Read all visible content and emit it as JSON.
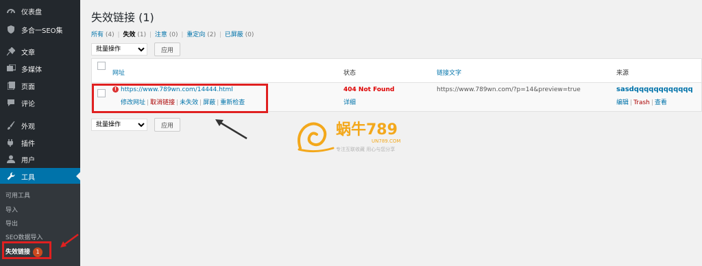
{
  "sidebar": {
    "items": [
      {
        "label": "仪表盘",
        "icon": "dashboard-icon"
      },
      {
        "label": "多合一SEO集",
        "icon": "seo-shield-icon"
      },
      {
        "label": "文章",
        "icon": "pin-icon"
      },
      {
        "label": "多媒体",
        "icon": "media-icon"
      },
      {
        "label": "页面",
        "icon": "page-icon"
      },
      {
        "label": "评论",
        "icon": "comment-icon"
      },
      {
        "label": "外观",
        "icon": "brush-icon"
      },
      {
        "label": "插件",
        "icon": "plugin-icon"
      },
      {
        "label": "用户",
        "icon": "user-icon"
      },
      {
        "label": "工具",
        "icon": "wrench-icon"
      }
    ],
    "submenu": [
      {
        "label": "可用工具"
      },
      {
        "label": "导入"
      },
      {
        "label": "导出"
      },
      {
        "label": "SEO数据导入"
      },
      {
        "label": "失效链接",
        "badge": "1"
      }
    ]
  },
  "main": {
    "title": "失效链接 (1)",
    "filters": [
      {
        "label": "所有",
        "count": "(4)"
      },
      {
        "label": "失效",
        "count": "(1)"
      },
      {
        "label": "注意",
        "count": "(0)"
      },
      {
        "label": "重定向",
        "count": "(2)"
      },
      {
        "label": "已屏蔽",
        "count": "(0)"
      }
    ],
    "bulk": {
      "select_value": "批量操作",
      "apply_label": "应用"
    },
    "table": {
      "headers": {
        "url": "网址",
        "status": "状态",
        "link_text": "链接文字",
        "source": "来源"
      },
      "row": {
        "url": "https://www.789wn.com/14444.html",
        "actions": [
          "修改网址",
          "取消链接",
          "未失效",
          "屏蔽",
          "重新检查"
        ],
        "status": "404 Not Found",
        "status_detail": "详细",
        "link_text": "https://www.789wn.com/?p=14&preview=true",
        "source_title": "sasdqqqqqqqqqqqq",
        "source_actions": [
          "编辑",
          "Trash",
          "查看"
        ]
      }
    }
  },
  "watermark": {
    "brand": "蜗牛789",
    "domain": "UN789.COM",
    "slogan": "专注互联收藏  用心与您分享"
  },
  "colors": {
    "sidebar_bg": "#23282d",
    "active": "#0073aa",
    "link": "#0073aa",
    "error": "#dc3232",
    "highlight": "#e02020"
  }
}
